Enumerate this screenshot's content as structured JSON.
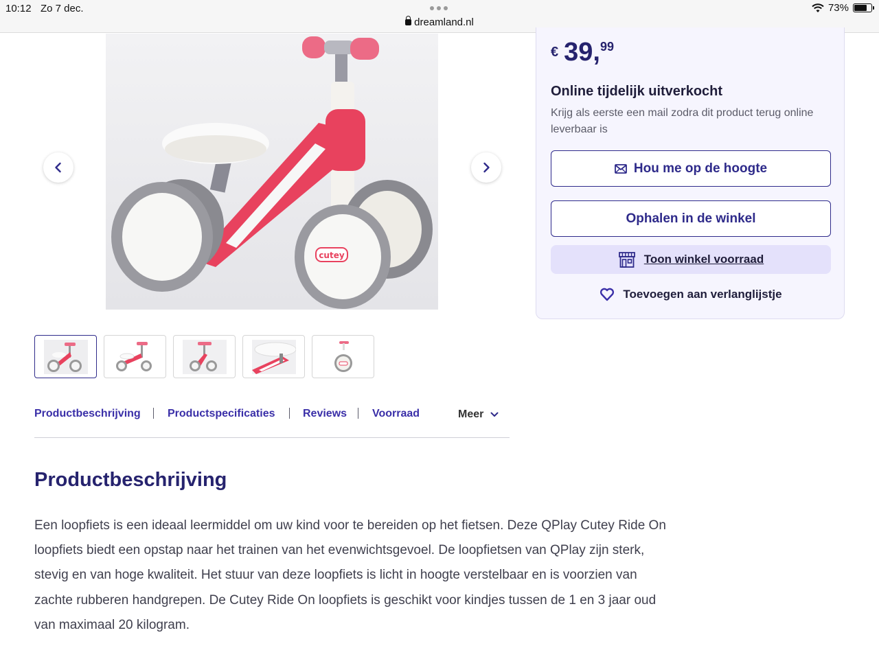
{
  "status_bar": {
    "time": "10:12",
    "date": "Zo 7 dec.",
    "url": "dreamland.nl",
    "battery": "73%"
  },
  "gallery": {
    "main_image_alt": "cutey",
    "thumbnails": [
      "thumb-1",
      "thumb-2",
      "thumb-3",
      "thumb-4",
      "thumb-5"
    ],
    "active_index": 0
  },
  "tabs": [
    {
      "label": "Productbeschrijving"
    },
    {
      "label": "Productspecificaties"
    },
    {
      "label": "Reviews"
    },
    {
      "label": "Voorraad"
    }
  ],
  "tabs_more": "Meer",
  "description": {
    "title": "Productbeschrijving",
    "text": "Een loopfiets is een ideaal leermiddel om uw kind voor te bereiden op het fietsen. Deze QPlay Cutey Ride On loopfiets biedt een opstap naar het trainen van het evenwichtsgevoel. De loopfietsen van QPlay zijn sterk, stevig en van hoge kwaliteit. Het stuur van deze loopfiets is licht in hoogte verstelbaar en is voorzien van zachte rubberen handgrepen. De Cutey Ride On loopfiets is geschikt voor kindjes tussen de 1 en 3 jaar oud van maximaal 20 kilogram."
  },
  "panel": {
    "price_currency": "€",
    "price_int": "39,",
    "price_dec": "99",
    "stock_title": "Online tijdelijk uitverkocht",
    "stock_text": "Krijg als eerste een mail zodra dit product terug online leverbaar is",
    "notify_label": "Hou me op de hoogte",
    "pickup_label": "Ophalen in de winkel",
    "store_stock_label": "Toon winkel voorraad",
    "wishlist_label": "Toevoegen aan verlanglijstje"
  },
  "colors": {
    "brand": "#2e2a8a",
    "title": "#26236e",
    "panel_bg": "#f6f5fe",
    "store_btn_bg": "#e4e1fb",
    "frame_pink": "#e8425e"
  }
}
